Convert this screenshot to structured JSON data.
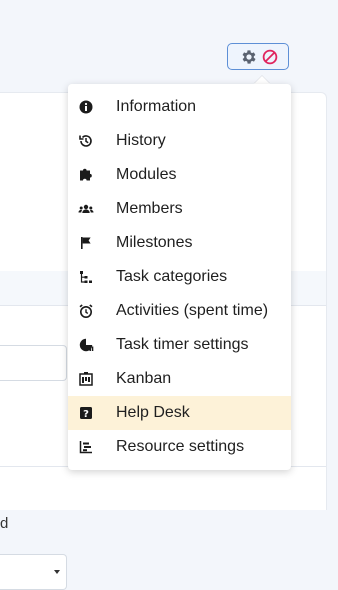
{
  "settings_button": {
    "gear_icon": "gear-icon",
    "close_icon": "ban-icon",
    "accent": "#5d8fd6",
    "close_color": "#e0245e"
  },
  "background": {
    "partial_text": "d"
  },
  "menu": {
    "items": [
      {
        "label": "Information",
        "icon": "info-circle-icon"
      },
      {
        "label": "History",
        "icon": "history-icon"
      },
      {
        "label": "Modules",
        "icon": "puzzle-icon"
      },
      {
        "label": "Members",
        "icon": "users-icon"
      },
      {
        "label": "Milestones",
        "icon": "flag-icon"
      },
      {
        "label": "Task categories",
        "icon": "tree-icon"
      },
      {
        "label": "Activities (spent time)",
        "icon": "alarm-clock-icon"
      },
      {
        "label": "Task timer settings",
        "icon": "timer-icon"
      },
      {
        "label": "Kanban",
        "icon": "kanban-icon"
      },
      {
        "label": "Help Desk",
        "icon": "help-icon",
        "active": true
      },
      {
        "label": "Resource settings",
        "icon": "resource-icon"
      }
    ],
    "active_color": "#fdf2d8"
  }
}
